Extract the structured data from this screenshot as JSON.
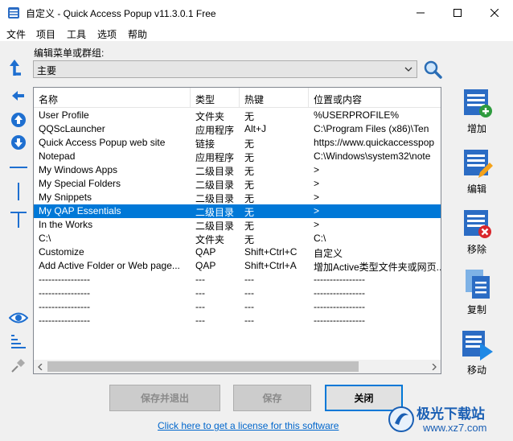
{
  "window": {
    "title": "自定义 - Quick Access Popup v11.3.0.1 Free"
  },
  "menu": [
    "文件",
    "项目",
    "工具",
    "选项",
    "帮助"
  ],
  "group_label": "编辑菜单或群组:",
  "combo": {
    "value": "主要"
  },
  "list": {
    "columns": [
      "名称",
      "类型",
      "热键",
      "位置或内容"
    ],
    "rows": [
      {
        "name": "User Profile",
        "type": "文件夹",
        "hotkey": "无",
        "location": "%USERPROFILE%",
        "selected": false
      },
      {
        "name": "QQScLauncher",
        "type": "应用程序",
        "hotkey": "Alt+J",
        "location": "C:\\Program Files (x86)\\Ten",
        "selected": false
      },
      {
        "name": "Quick Access Popup web site",
        "type": "链接",
        "hotkey": "无",
        "location": "https://www.quickaccesspop",
        "selected": false
      },
      {
        "name": "Notepad",
        "type": "应用程序",
        "hotkey": "无",
        "location": "C:\\Windows\\system32\\note",
        "selected": false
      },
      {
        "name": "My Windows Apps",
        "type": "二级目录",
        "hotkey": "无",
        "location": ">",
        "selected": false
      },
      {
        "name": "My Special Folders",
        "type": "二级目录",
        "hotkey": "无",
        "location": ">",
        "selected": false
      },
      {
        "name": "My Snippets",
        "type": "二级目录",
        "hotkey": "无",
        "location": ">",
        "selected": false
      },
      {
        "name": "My QAP Essentials",
        "type": "二级目录",
        "hotkey": "无",
        "location": ">",
        "selected": true
      },
      {
        "name": "In the Works",
        "type": "二级目录",
        "hotkey": "无",
        "location": ">",
        "selected": false
      },
      {
        "name": "C:\\",
        "type": "文件夹",
        "hotkey": "无",
        "location": "C:\\",
        "selected": false
      },
      {
        "name": "Customize",
        "type": "QAP",
        "hotkey": "Shift+Ctrl+C",
        "location": "自定义",
        "selected": false
      },
      {
        "name": "Add Active Folder or Web page...",
        "type": "QAP",
        "hotkey": "Shift+Ctrl+A",
        "location": "增加Active类型文件夹或网页...",
        "selected": false
      },
      {
        "name": "----------------",
        "type": "---",
        "hotkey": "---",
        "location": "----------------",
        "selected": false
      },
      {
        "name": "----------------",
        "type": "---",
        "hotkey": "---",
        "location": "----------------",
        "selected": false
      },
      {
        "name": "----------------",
        "type": "---",
        "hotkey": "---",
        "location": "----------------",
        "selected": false
      },
      {
        "name": "----------------",
        "type": "---",
        "hotkey": "---",
        "location": "----------------",
        "selected": false
      }
    ]
  },
  "actions": [
    {
      "label": "增加",
      "icon": "add-icon"
    },
    {
      "label": "编辑",
      "icon": "edit-icon"
    },
    {
      "label": "移除",
      "icon": "remove-icon"
    },
    {
      "label": "复制",
      "icon": "copy-icon"
    },
    {
      "label": "移动",
      "icon": "move-icon"
    }
  ],
  "buttons": {
    "save_exit": "保存并退出",
    "save": "保存",
    "close": "关闭"
  },
  "license_link": "Click here to get a license for this software",
  "watermark": {
    "line1": "极光下载站",
    "line2": "www.xz7.com"
  },
  "colors": {
    "accent": "#0078d7",
    "link": "#0066cc",
    "icon_blue": "#1e6fd0"
  }
}
